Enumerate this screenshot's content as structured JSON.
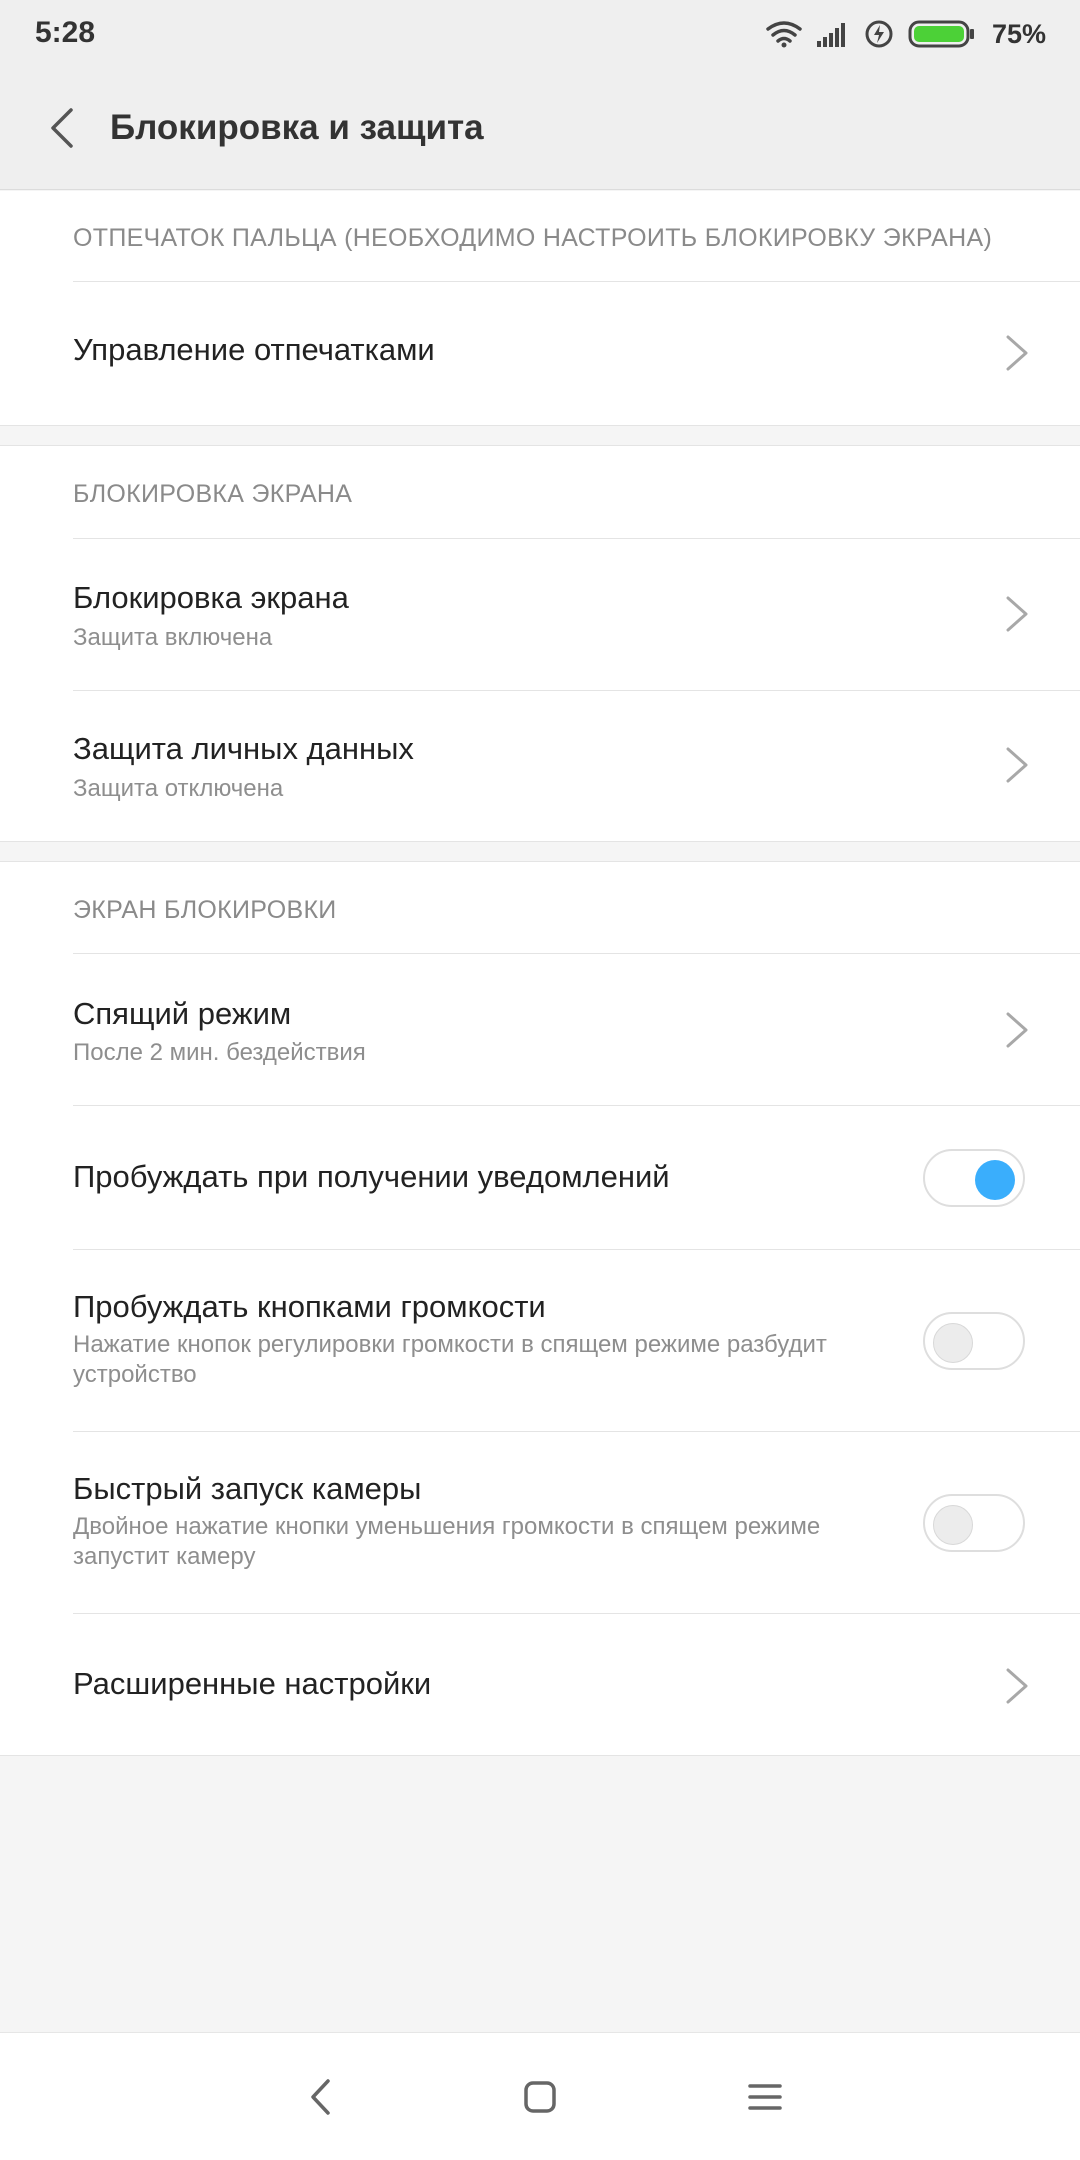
{
  "status_bar": {
    "time": "5:28",
    "battery_percent": "75%",
    "icons": [
      "wifi-icon",
      "signal-icon",
      "charging-icon",
      "battery-icon"
    ],
    "battery_color": "#4cd137"
  },
  "header": {
    "title": "Блокировка и защита",
    "back_icon": "back-arrow-icon"
  },
  "sections": [
    {
      "header": "ОТПЕЧАТОК ПАЛЬЦА (НЕОБХОДИМО НАСТРОИТЬ БЛОКИРОВКУ ЭКРАНА)",
      "items": [
        {
          "title": "Управление отпечатками",
          "type": "link"
        }
      ]
    },
    {
      "header": "БЛОКИРОВКА ЭКРАНА",
      "items": [
        {
          "title": "Блокировка экрана",
          "subtitle": "Защита включена",
          "type": "link"
        },
        {
          "title": "Защита личных данных",
          "subtitle": "Защита отключена",
          "type": "link"
        }
      ]
    },
    {
      "header": "ЭКРАН БЛОКИРОВКИ",
      "items": [
        {
          "title": "Спящий режим",
          "subtitle": "После 2 мин. бездействия",
          "type": "link"
        },
        {
          "title": "Пробуждать при получении уведомлений",
          "type": "toggle",
          "enabled": true
        },
        {
          "title": "Пробуждать кнопками громкости",
          "subtitle": "Нажатие кнопок регулировки громкости в спящем режиме разбудит устройство",
          "type": "toggle",
          "enabled": false
        },
        {
          "title": "Быстрый запуск камеры",
          "subtitle": "Двойное нажатие кнопки уменьшения громкости в спящем режиме запустит камеру",
          "type": "toggle",
          "enabled": false
        },
        {
          "title": "Расширенные настройки",
          "type": "link"
        }
      ]
    }
  ],
  "navbar": {
    "buttons": [
      "nav-back-icon",
      "nav-home-icon",
      "nav-menu-icon"
    ]
  },
  "colors": {
    "accent": "#3aaefc",
    "background": "#f5f5f5",
    "header_bg": "#efefef"
  }
}
